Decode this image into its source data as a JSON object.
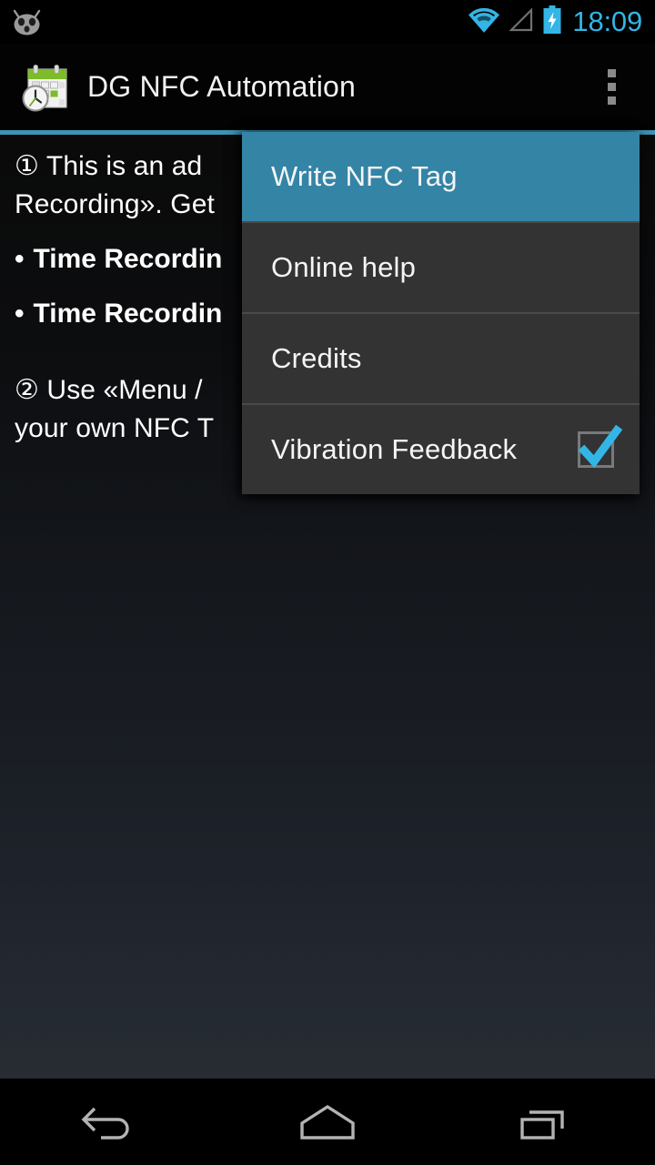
{
  "status_bar": {
    "logo_icon": "cyanogenmod-head-icon",
    "icons": [
      "wifi-icon",
      "signal-icon",
      "battery-charging-icon"
    ],
    "time": "18:09",
    "accent_color": "#33b5e5"
  },
  "action_bar": {
    "app_icon": "calendar-clock-icon",
    "title": "DG NFC Automation",
    "overflow_icon": "overflow-menu-icon",
    "divider_color": "#3d93b4"
  },
  "content": {
    "paragraph1_line1": "① This is an ad",
    "paragraph1_line2": "Recording». Get",
    "bullet1": "Time Recordin",
    "bullet2": "Time Recordin",
    "bullet_marker": "•",
    "paragraph2_line1": "② Use «Menu /",
    "paragraph2_line2": "your own NFC T"
  },
  "popup_menu": {
    "items": [
      {
        "label": "Write NFC Tag",
        "highlighted": true,
        "has_checkbox": false
      },
      {
        "label": "Online help",
        "highlighted": false,
        "has_checkbox": false
      },
      {
        "label": "Credits",
        "highlighted": false,
        "has_checkbox": false
      },
      {
        "label": "Vibration Feedback",
        "highlighted": false,
        "has_checkbox": true,
        "checked": true
      }
    ],
    "highlight_color": "#3484a6",
    "background_color": "#333333",
    "checkbox_check_color": "#33b5e5"
  },
  "nav_bar": {
    "back_label": "back-icon",
    "home_label": "home-icon",
    "recents_label": "recents-icon"
  }
}
